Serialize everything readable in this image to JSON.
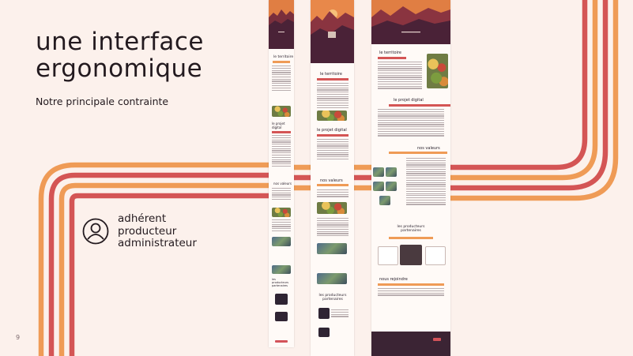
{
  "title_lines": [
    "une interface",
    "ergonomique"
  ],
  "subtitle": "Notre principale contrainte",
  "roles": [
    "adhérent",
    "producteur",
    "administrateur"
  ],
  "page_number": "9",
  "colors": {
    "background": "#fcf1ec",
    "stripe_orange": "#ef9b56",
    "stripe_red": "#d45555",
    "dark": "#3b2434"
  },
  "icons": {
    "user": "user-circle-icon"
  },
  "mockups": {
    "mobile": {
      "headings": [
        "le territoire",
        "le projet digital",
        "nos valeurs",
        "les producteurs partenaires"
      ]
    },
    "tablet": {
      "headings": [
        "le territoire",
        "le projet digital",
        "nos valeurs",
        "les producteurs partenaires"
      ]
    },
    "desktop": {
      "headings": [
        "le territoire",
        "le projet digital",
        "nos valeurs",
        "les producteurs partenaires",
        "nous rejoindre"
      ]
    }
  }
}
